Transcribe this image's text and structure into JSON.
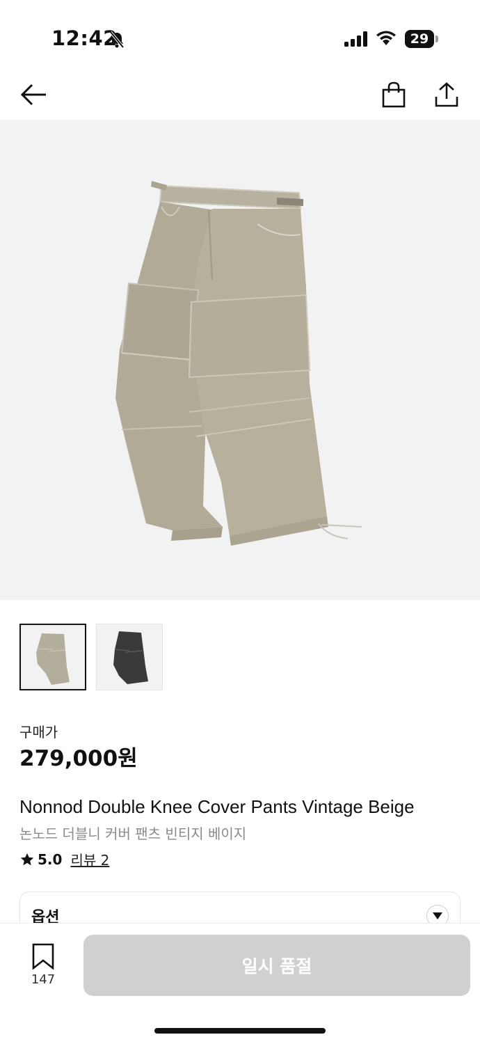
{
  "status_bar": {
    "time": "12:42",
    "battery": "29"
  },
  "product": {
    "price_label": "구매가",
    "price": "279,000원",
    "title_en": "Nonnod Double Knee Cover Pants Vintage Beige",
    "title_ko": "논노드 더블니 커버 팬츠 빈티지 베이지",
    "rating": "5.0",
    "review_link": "리뷰 2"
  },
  "options": {
    "label": "옵션"
  },
  "bottom_bar": {
    "bookmark_count": "147",
    "soldout_label": "일시 품절"
  },
  "colors": {
    "hero_bg": "#f2f2f2",
    "pants_beige": "#b3ad9b",
    "pants_black": "#3a3a3a",
    "soldout_bg": "#d0d0d0"
  },
  "icons": [
    "back-arrow-icon",
    "shopping-bag-icon",
    "share-icon",
    "star-icon",
    "bookmark-icon",
    "chevron-down-icon",
    "bell-slash-icon",
    "signal-icon",
    "wifi-icon"
  ]
}
